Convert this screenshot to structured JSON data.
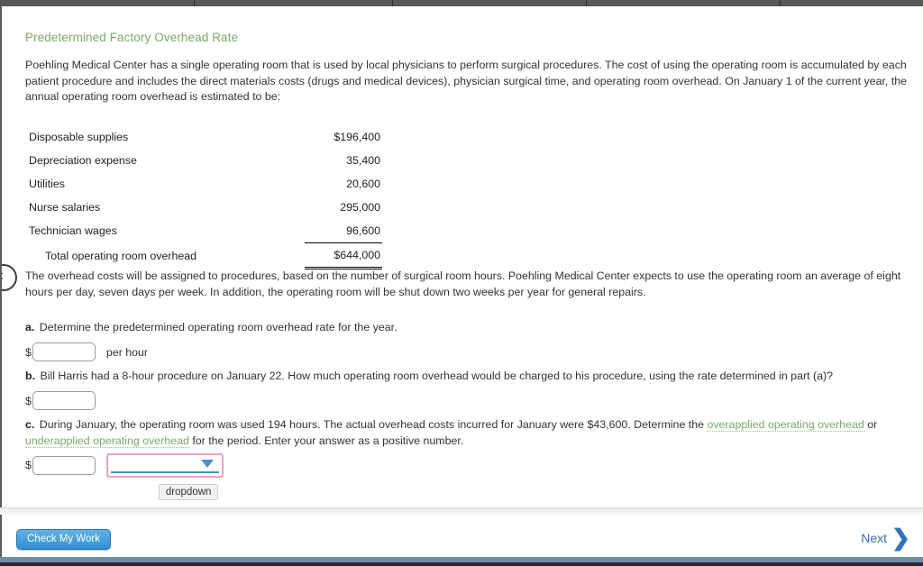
{
  "top_strip": {
    "tab_divider_positions": [
      215,
      435,
      650,
      865
    ]
  },
  "page_title": "Predetermined Factory Overhead Rate",
  "intro_paragraph": "Poehling Medical Center has a single operating room that is used by local physicians to perform surgical procedures. The cost of using the operating room is accumulated by each patient procedure and includes the direct materials costs (drugs and medical devices), physician surgical time, and operating room overhead. On January 1 of the current year, the annual operating room overhead is estimated to be:",
  "cost_table": {
    "rows": [
      {
        "label": "Disposable supplies",
        "amount": "$196,400"
      },
      {
        "label": "Depreciation expense",
        "amount": "35,400"
      },
      {
        "label": "Utilities",
        "amount": "20,600"
      },
      {
        "label": "Nurse salaries",
        "amount": "295,000"
      },
      {
        "label": "Technician wages",
        "amount": "96,600"
      }
    ],
    "total_label": "Total operating room overhead",
    "total_amount": "$644,000"
  },
  "assignment_paragraph": "The overhead costs will be assigned to procedures, based on the number of surgical room hours. Poehling Medical Center expects to use the operating room an average of eight hours per day, seven days per week. In addition, the operating room will be shut down two weeks per year for general repairs.",
  "questions": {
    "a": {
      "letter": "a.",
      "text": "Determine the predetermined operating room overhead rate for the year.",
      "dollar_sign": "$",
      "input_value": "",
      "unit": "per hour"
    },
    "b": {
      "letter": "b.",
      "text": "Bill Harris had a 8-hour procedure on January 22. How much operating room overhead would be charged to his procedure, using the rate determined in part (a)?",
      "dollar_sign": "$",
      "input_value": ""
    },
    "c": {
      "letter": "c.",
      "text_part1": "During January, the operating room was used 194 hours. The actual overhead costs incurred for January were $43,600. Determine the ",
      "link1": "overapplied operating overhead",
      "text_mid": " or ",
      "link2": "underapplied operating overhead",
      "text_part2": " for the period. Enter your answer as a positive number.",
      "dollar_sign": "$",
      "input_value": "",
      "dropdown_value": "",
      "dropdown_tooltip": "dropdown"
    }
  },
  "footer": {
    "check_work_label": "Check My Work",
    "next_label": "Next",
    "next_chevron": "❯"
  },
  "colors": {
    "title_green": "#7aab68",
    "glossary_green": "#7aab68",
    "dropdown_border_pink": "#f2a0bd",
    "dropdown_accent_blue": "#4d8fcc",
    "button_blue": "#2f8fd4",
    "link_blue": "#2f73bd"
  }
}
